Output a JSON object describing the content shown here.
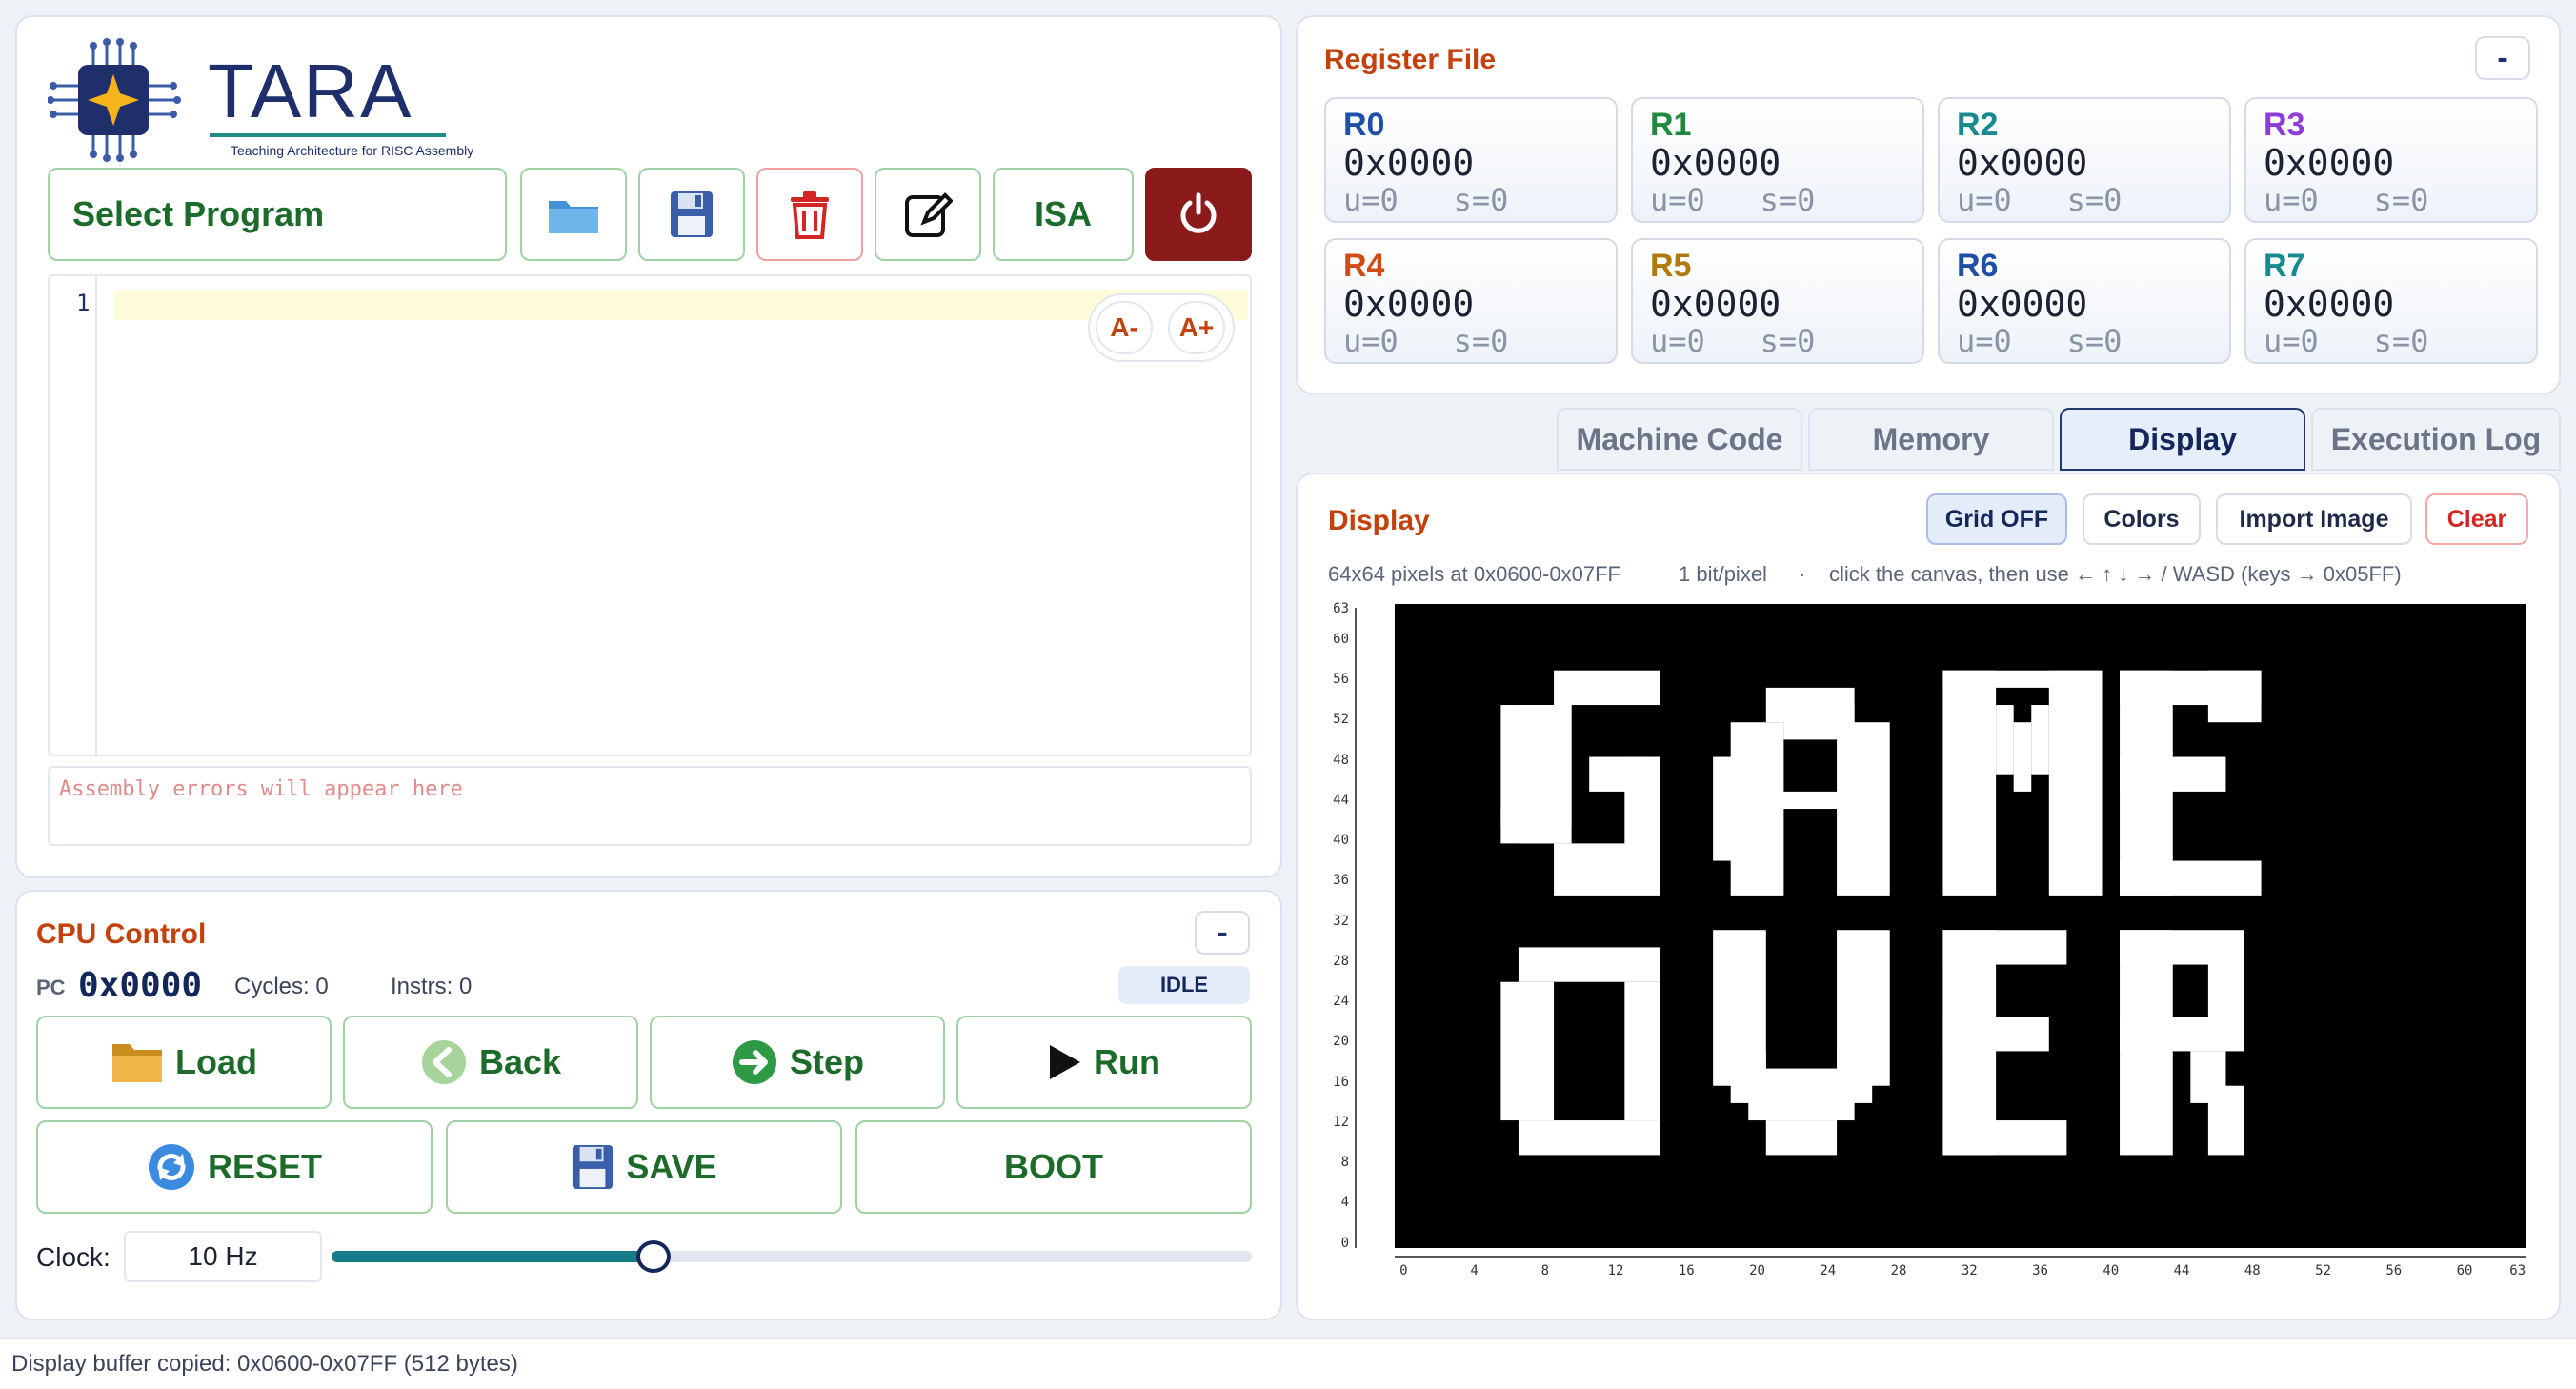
{
  "app": {
    "logo_title": "TARA",
    "logo_subtitle": "Teaching Architecture for RISC Assembly"
  },
  "editor": {
    "select_program": "Select Program",
    "isa_label": "ISA",
    "line_number": "1",
    "font_dec": "A-",
    "font_inc": "A+",
    "errors_placeholder": "Assembly errors will appear here"
  },
  "cpu": {
    "title": "CPU Control",
    "collapse": "-",
    "pc_label": "PC",
    "pc_value": "0x0000",
    "cycles": "Cycles: 0",
    "instrs": "Instrs: 0",
    "state": "IDLE",
    "buttons": {
      "load": "Load",
      "back": "Back",
      "step": "Step",
      "run": "Run",
      "reset": "RESET",
      "save": "SAVE",
      "boot": "BOOT"
    },
    "clock_label": "Clock:",
    "clock_value": "10 Hz",
    "clock_level_fraction": 0.35
  },
  "registers": {
    "title": "Register File",
    "collapse": "-",
    "items": [
      {
        "name": "R0",
        "hex": "0x0000",
        "us": "u=0   s=0",
        "color": "#1f4fa8"
      },
      {
        "name": "R1",
        "hex": "0x0000",
        "us": "u=0   s=0",
        "color": "#1e8a3e"
      },
      {
        "name": "R2",
        "hex": "0x0000",
        "us": "u=0   s=0",
        "color": "#178a8f"
      },
      {
        "name": "R3",
        "hex": "0x0000",
        "us": "u=0   s=0",
        "color": "#8e3bd8"
      },
      {
        "name": "R4",
        "hex": "0x0000",
        "us": "u=0   s=0",
        "color": "#d14b17"
      },
      {
        "name": "R5",
        "hex": "0x0000",
        "us": "u=0   s=0",
        "color": "#b07a0c"
      },
      {
        "name": "R6",
        "hex": "0x0000",
        "us": "u=0   s=0",
        "color": "#1f4fa8"
      },
      {
        "name": "R7",
        "hex": "0x0000",
        "us": "u=0   s=0",
        "color": "#178a8f"
      }
    ]
  },
  "tabs": [
    {
      "label": "Machine Code",
      "active": false
    },
    {
      "label": "Memory",
      "active": false
    },
    {
      "label": "Display",
      "active": true
    },
    {
      "label": "Execution Log",
      "active": false
    }
  ],
  "display": {
    "title": "Display",
    "grid_btn": "Grid OFF",
    "colors_btn": "Colors",
    "import_btn": "Import Image",
    "clear_btn": "Clear",
    "info_size": "64x64 pixels at 0x0600-0x07FF",
    "info_depth": "1 bit/pixel",
    "info_sep": "·",
    "info_hint": "click the canvas, then use ← ↑ ↓ → / WASD (keys → 0x05FF)",
    "y_ticks": [
      "63",
      "60",
      "56",
      "52",
      "48",
      "44",
      "40",
      "36",
      "32",
      "28",
      "24",
      "20",
      "16",
      "12",
      "8",
      "4",
      "0"
    ],
    "x_ticks": [
      "0",
      "4",
      "8",
      "12",
      "16",
      "20",
      "24",
      "28",
      "32",
      "36",
      "40",
      "44",
      "48",
      "52",
      "56",
      "60",
      "63"
    ],
    "text_shown": "GAME OVER"
  },
  "status_bar": "Display buffer copied: 0x0600-0x07FF (512 bytes)",
  "colors": {
    "accent_orange": "#c2410c",
    "power_red": "#8b1a1a",
    "slider_teal": "#167c8a",
    "green_text": "#1d6b2a"
  }
}
